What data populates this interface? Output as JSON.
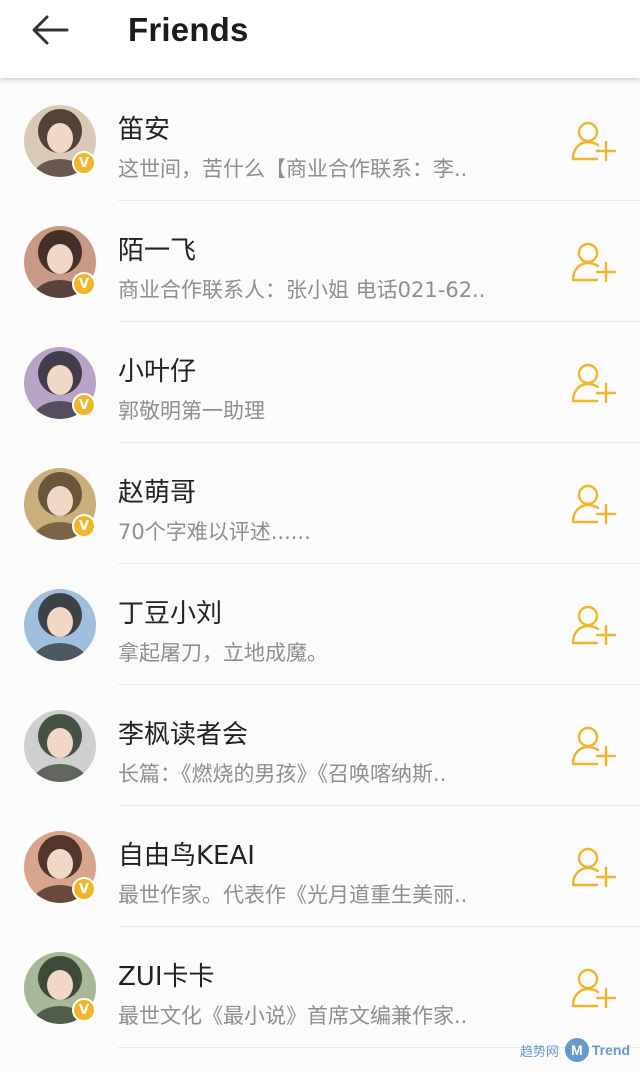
{
  "header": {
    "title": "Friends",
    "back_icon": "arrow-left-icon"
  },
  "theme": {
    "accent": "#f0b52a",
    "name_color": "#222222",
    "desc_color": "#8f8f8f"
  },
  "friends": [
    {
      "name": "笛安",
      "desc": "这世间，苦什么【商业合作联系：李..",
      "verified": true,
      "avatar_colors": [
        "#d9c9b6",
        "#3b2a22"
      ]
    },
    {
      "name": "陌一飞",
      "desc": "商业合作联系人：张小姐 电话021-62..",
      "verified": true,
      "avatar_colors": [
        "#c89a86",
        "#2a1d19"
      ]
    },
    {
      "name": "小叶仔",
      "desc": "郭敬明第一助理",
      "verified": true,
      "avatar_colors": [
        "#b9a3c6",
        "#2e2a35"
      ]
    },
    {
      "name": "赵萌哥",
      "desc": "70个字难以评述......",
      "verified": true,
      "avatar_colors": [
        "#c9b07a",
        "#5b4630"
      ]
    },
    {
      "name": "丁豆小刘",
      "desc": "拿起屠刀，立地成魔。",
      "verified": false,
      "avatar_colors": [
        "#9ec0dd",
        "#2c2c2c"
      ]
    },
    {
      "name": "李枫读者会",
      "desc": "长篇：《燃烧的男孩》《召唤喀纳斯..",
      "verified": false,
      "avatar_colors": [
        "#cfcfcf",
        "#2f3a2c"
      ]
    },
    {
      "name": "自由鸟KEAI",
      "desc": "最世作家。代表作《光月道重生美丽..",
      "verified": true,
      "avatar_colors": [
        "#d8a48b",
        "#3b221a"
      ]
    },
    {
      "name": "ZUI卡卡",
      "desc": "最世文化《最小说》首席文编兼作家..",
      "verified": true,
      "avatar_colors": [
        "#a7b89a",
        "#2c3526"
      ]
    }
  ],
  "row_icons": {
    "verified_mark": "V",
    "add_friend_icon": "add-person-icon"
  },
  "watermark": {
    "cn": "趋势网",
    "logo": "M",
    "brand": "Trend"
  }
}
